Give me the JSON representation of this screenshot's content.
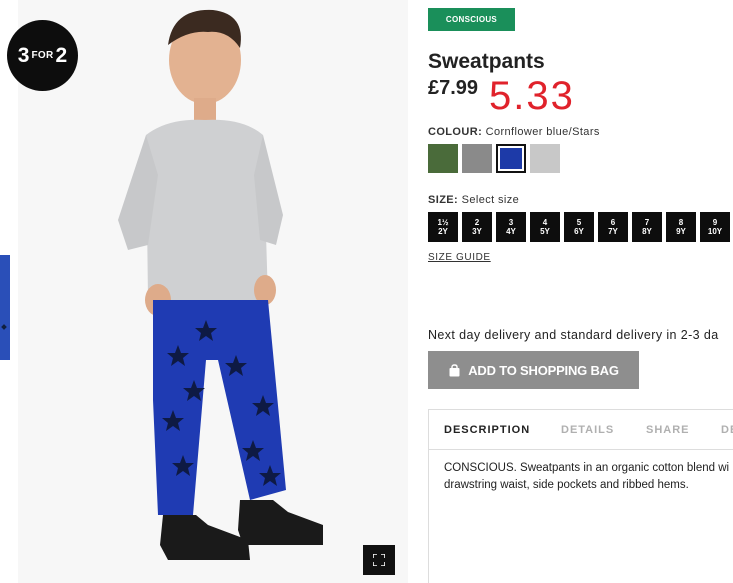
{
  "promo": {
    "num1": "3",
    "for": "FOR",
    "num2": "2"
  },
  "product": {
    "badge": "CONSCIOUS",
    "title": "Sweatpants",
    "price": "£7.99",
    "sale_price": "5.33"
  },
  "colour": {
    "label": "COLOUR:",
    "selected": "Cornflower blue/Stars",
    "swatches": [
      {
        "name": "green",
        "color": "#4a6b3a"
      },
      {
        "name": "grey",
        "color": "#8a8a8a"
      },
      {
        "name": "cornflower-blue-stars",
        "color": "#1d3aa8"
      },
      {
        "name": "light-grey",
        "color": "#c8c8c8"
      }
    ]
  },
  "size": {
    "label": "SIZE:",
    "placeholder": "Select size",
    "options": [
      {
        "top": "1½",
        "bottom": "2Y"
      },
      {
        "top": "2",
        "bottom": "3Y"
      },
      {
        "top": "3",
        "bottom": "4Y"
      },
      {
        "top": "4",
        "bottom": "5Y"
      },
      {
        "top": "5",
        "bottom": "6Y"
      },
      {
        "top": "6",
        "bottom": "7Y"
      },
      {
        "top": "7",
        "bottom": "8Y"
      },
      {
        "top": "8",
        "bottom": "9Y"
      },
      {
        "top": "9",
        "bottom": "10Y"
      }
    ],
    "guide": "SIZE GUIDE"
  },
  "delivery": "Next day delivery and standard delivery in 2-3 da",
  "add_to_bag": "ADD TO SHOPPING BAG",
  "tabs": [
    "DESCRIPTION",
    "DETAILS",
    "SHARE",
    "DE"
  ],
  "description": "CONSCIOUS. Sweatpants in an organic cotton blend wi drawstring waist, side pockets and ribbed hems.",
  "colors": {
    "badge": "#1a8f5a",
    "sale_price": "#e0222b",
    "add_button": "#8e8e8e"
  }
}
